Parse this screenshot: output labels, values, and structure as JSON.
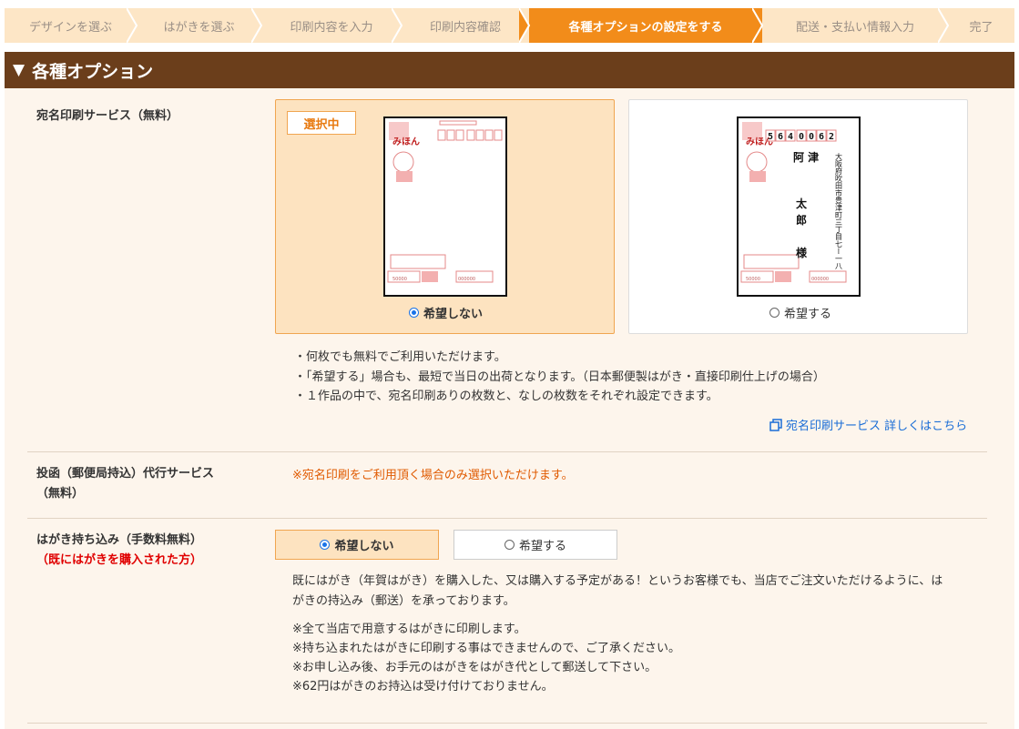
{
  "steps": [
    {
      "label": "デザインを選ぶ",
      "active": false
    },
    {
      "label": "はがきを選ぶ",
      "active": false
    },
    {
      "label": "印刷内容を入力",
      "active": false
    },
    {
      "label": "印刷内容確認",
      "active": false
    },
    {
      "label": "各種オプションの設定をする",
      "active": true
    },
    {
      "label": "配送・支払い情報入力",
      "active": false
    },
    {
      "label": "完了",
      "active": false
    }
  ],
  "section": {
    "title": "各種オプション",
    "toggle_icon": "▼"
  },
  "address_print": {
    "label": "宛名印刷サービス（無料）",
    "selected_badge": "選択中",
    "option_no": "希望しない",
    "option_yes": "希望する",
    "selected": "no",
    "postcard": {
      "brand": "みほん",
      "zip": [
        "5",
        "6",
        "4",
        "0",
        "0",
        "6",
        "2"
      ],
      "name_lines": [
        "阿 津",
        "太",
        "郎",
        "様"
      ],
      "address": "大阪府吹田市豊津町三丁目七ー一八"
    },
    "notes": [
      "・何枚でも無料でご利用いただけます。",
      "・「希望する」場合も、最短で当日の出荷となります。（日本郵便製はがき・直接印刷仕上げの場合）",
      "・１作品の中で、宛名印刷ありの枚数と、なしの枚数をそれぞれ設定できます。"
    ],
    "link_text": "宛名印刷サービス 詳しくはこちら",
    "link_icon": "copy-icon"
  },
  "mail_service": {
    "label_line1": "投函（郵便局持込）代行サービス",
    "label_line2": "（無料）",
    "note": "※宛名印刷をご利用頂く場合のみ選択いただけます。"
  },
  "postcard_bringin": {
    "label": "はがき持ち込み（手数料無料）",
    "sublabel": "（既にはがきを購入された方）",
    "option_no": "希望しない",
    "option_yes": "希望する",
    "selected": "no",
    "description_line1": "既にはがき（年賀はがき）を購入した、又は購入する予定がある！というお客様でも、当店でご注文いただけるように、は",
    "description_line2": "がきの持込み（郵送）を承っております。",
    "notes": [
      "※全て当店で用意するはがきに印刷します。",
      "※持ち込まれたはがきに印刷する事はできませんので、ご了承ください。",
      "※お申し込み後、お手元のはがきをはがき代として郵送して下さい。",
      "※62円はがきのお持込は受け付けておりません。"
    ]
  },
  "colors": {
    "accent": "#f28c1a",
    "header_bg": "#6b3e1b",
    "step_bg": "#fde6c6",
    "selected_bg": "#fde3c0",
    "link": "#1a6dd6",
    "warn": "#e05a00"
  }
}
